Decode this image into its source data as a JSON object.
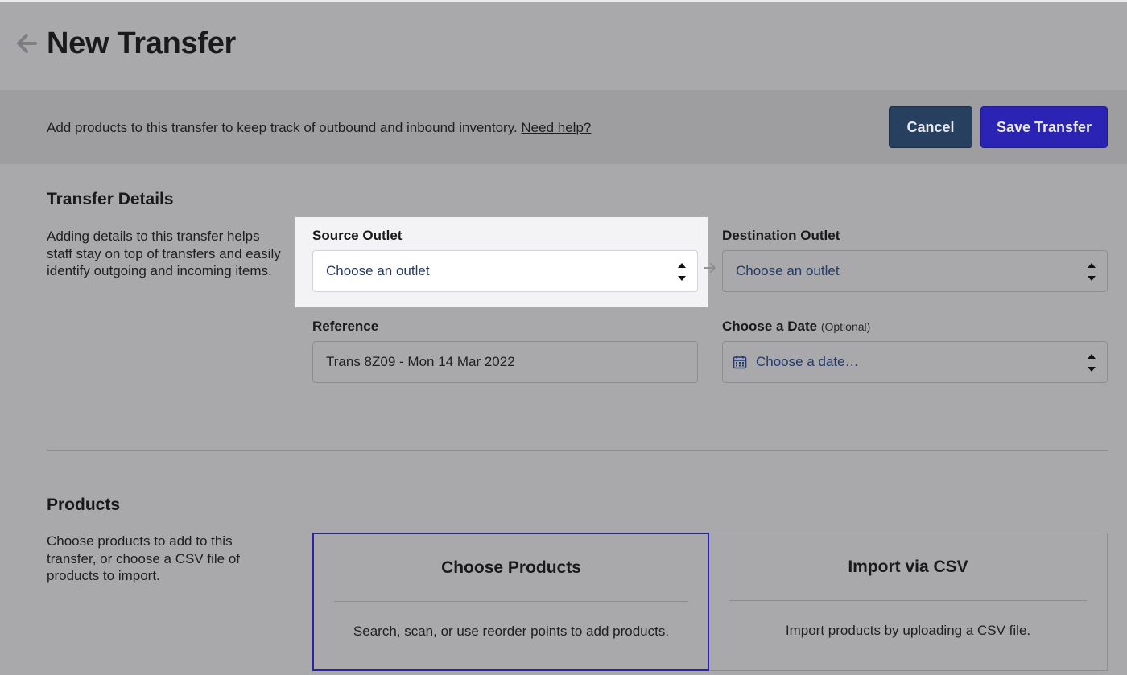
{
  "header": {
    "title": "New Transfer",
    "back_icon": "arrow-left-icon"
  },
  "banner": {
    "text": "Add products to this transfer to keep track of outbound and inbound inventory.",
    "help_link": "Need help?",
    "cancel_label": "Cancel",
    "save_label": "Save Transfer"
  },
  "transfer_details": {
    "title": "Transfer Details",
    "description": "Adding details to this transfer helps staff stay on top of transfers and easily identify outgoing and incoming items.",
    "source_outlet": {
      "label": "Source Outlet",
      "value": "Choose an outlet"
    },
    "destination_outlet": {
      "label": "Destination Outlet",
      "value": "Choose an outlet"
    },
    "reference": {
      "label": "Reference",
      "value": "Trans 8Z09 - Mon 14 Mar 2022"
    },
    "date": {
      "label": "Choose a Date",
      "optional": "(Optional)",
      "value": "Choose a date…",
      "icon": "calendar-icon"
    }
  },
  "products": {
    "title": "Products",
    "description": "Choose products to add to this transfer, or choose a CSV file of products to import.",
    "choose_card": {
      "title": "Choose Products",
      "description": "Search, scan, or use reorder points to add products."
    },
    "import_card": {
      "title": "Import via CSV",
      "description": "Import products by uploading a CSV file."
    }
  },
  "colors": {
    "page_bg": "#a9a8ab",
    "banner_bg": "#9e9da0",
    "cancel_bg": "#27405f",
    "save_bg": "#2b23b3",
    "selected_card_border": "#2a23a8",
    "select_text": "#243a6b"
  }
}
